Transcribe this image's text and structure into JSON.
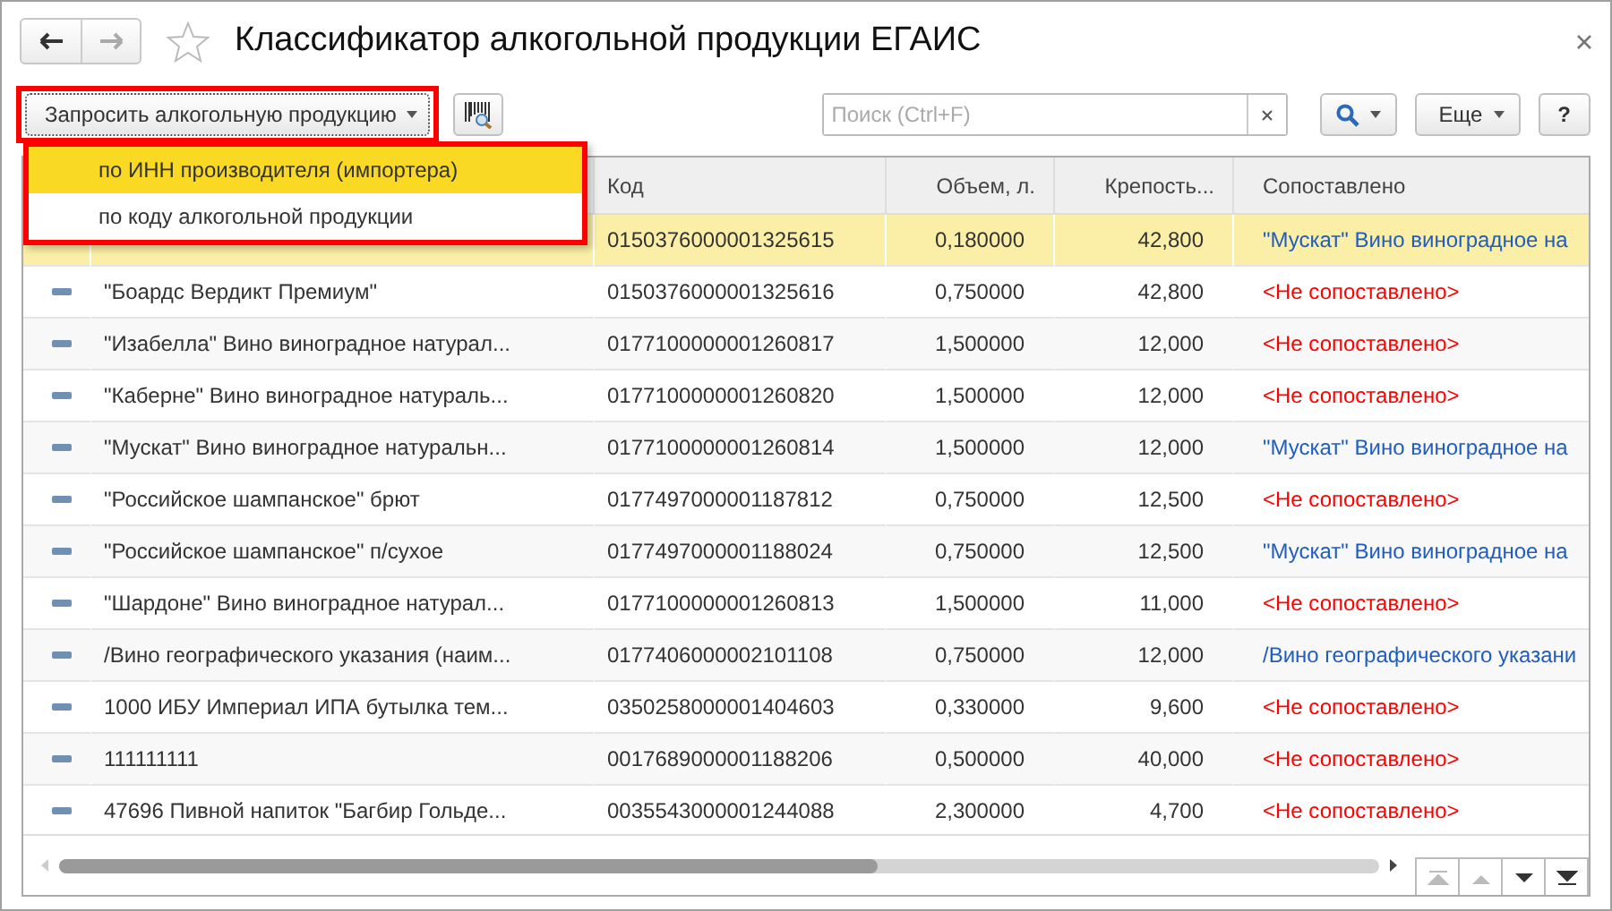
{
  "window": {
    "title": "Классификатор алкогольной продукции ЕГАИС",
    "back_disabled": false,
    "forward_disabled": true
  },
  "toolbar": {
    "request_button": "Запросить алкогольную продукцию",
    "search": {
      "placeholder": "Поиск (Ctrl+F)"
    },
    "more_button": "Еще",
    "help_button": "?"
  },
  "menu": {
    "items": [
      {
        "label": "по ИНН производителя (импортера)",
        "selected": true
      },
      {
        "label": "по коду алкогольной продукции",
        "selected": false
      }
    ]
  },
  "table": {
    "columns": [
      "Код",
      "Объем, л.",
      "Крепость...",
      "Сопоставлено"
    ],
    "rows": [
      {
        "selected": true,
        "code": "0150376000001325615",
        "volume": "0,180000",
        "strength": "42,800",
        "matched": "\"Мускат\" Вино виноградное на",
        "kind": "matched"
      },
      {
        "selected": false,
        "name": "\"Боардс Вердикт Премиум\"",
        "code": "0150376000001325616",
        "volume": "0,750000",
        "strength": "42,800",
        "matched": "<Не сопоставлено>",
        "kind": "unmatched"
      },
      {
        "selected": false,
        "name": "\"Изабелла\" Вино виноградное натурал...",
        "code": "0177100000001260817",
        "volume": "1,500000",
        "strength": "12,000",
        "matched": "<Не сопоставлено>",
        "kind": "unmatched"
      },
      {
        "selected": false,
        "name": "\"Каберне\" Вино виноградное натураль...",
        "code": "0177100000001260820",
        "volume": "1,500000",
        "strength": "12,000",
        "matched": "<Не сопоставлено>",
        "kind": "unmatched"
      },
      {
        "selected": false,
        "name": "\"Мускат\" Вино виноградное натуральн...",
        "code": "0177100000001260814",
        "volume": "1,500000",
        "strength": "12,000",
        "matched": "\"Мускат\" Вино виноградное на",
        "kind": "matched"
      },
      {
        "selected": false,
        "name": "\"Российское шампанское\" брют",
        "code": "0177497000001187812",
        "volume": "0,750000",
        "strength": "12,500",
        "matched": "<Не сопоставлено>",
        "kind": "unmatched"
      },
      {
        "selected": false,
        "name": "\"Российское шампанское\" п/сухое",
        "code": "0177497000001188024",
        "volume": "0,750000",
        "strength": "12,500",
        "matched": "\"Мускат\" Вино виноградное на",
        "kind": "matched"
      },
      {
        "selected": false,
        "name": "\"Шардоне\" Вино виноградное натурал...",
        "code": "0177100000001260813",
        "volume": "1,500000",
        "strength": "11,000",
        "matched": "<Не сопоставлено>",
        "kind": "unmatched"
      },
      {
        "selected": false,
        "name": "/Вино географического указания (наим...",
        "code": "0177406000002101108",
        "volume": "0,750000",
        "strength": "12,000",
        "matched": "/Вино географического указани",
        "kind": "matched"
      },
      {
        "selected": false,
        "name": "1000 ИБУ Империал ИПА бутылка тем...",
        "code": "0350258000001404603",
        "volume": "0,330000",
        "strength": "9,600",
        "matched": "<Не сопоставлено>",
        "kind": "unmatched"
      },
      {
        "selected": false,
        "name": "111111111",
        "code": "0017689000001188206",
        "volume": "0,500000",
        "strength": "40,000",
        "matched": "<Не сопоставлено>",
        "kind": "unmatched"
      },
      {
        "selected": false,
        "name": "47696 Пивной напиток \"Багбир Гольде...",
        "code": "0035543000001244088",
        "volume": "2,300000",
        "strength": "4,700",
        "matched": "<Не сопоставлено>",
        "kind": "unmatched"
      }
    ]
  },
  "pager": [
    {
      "kind": "first",
      "disabled": true
    },
    {
      "kind": "up",
      "disabled": true
    },
    {
      "kind": "down",
      "disabled": false
    },
    {
      "kind": "last",
      "disabled": false
    }
  ]
}
